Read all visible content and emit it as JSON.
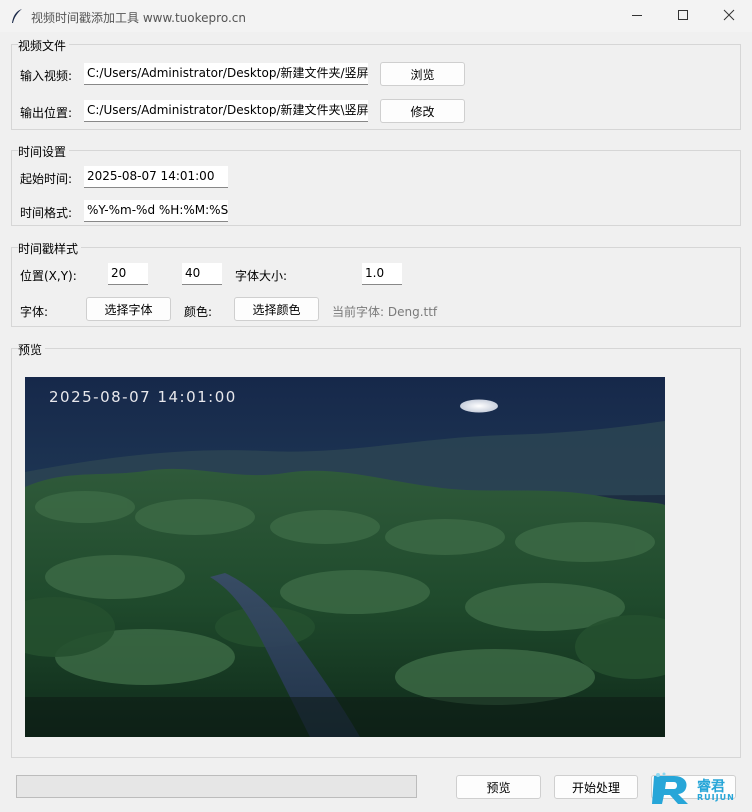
{
  "window": {
    "title": "视频时间戳添加工具  www.tuokepro.cn"
  },
  "video_file": {
    "group_label": "视频文件",
    "input_label": "输入视频:",
    "input_value": "C:/Users/Administrator/Desktop/新建文件夹/竖屏",
    "browse_label": "浏览",
    "output_label": "输出位置:",
    "output_value": "C:/Users/Administrator/Desktop/新建文件夹\\竖屏",
    "modify_label": "修改"
  },
  "time_settings": {
    "group_label": "时间设置",
    "start_label": "起始时间:",
    "start_value": "2025-08-07 14:01:00",
    "format_label": "时间格式:",
    "format_value": "%Y-%m-%d %H:%M:%S"
  },
  "style": {
    "group_label": "时间戳样式",
    "position_label": "位置(X,Y):",
    "x_value": "20",
    "y_value": "40",
    "font_size_label": "字体大小:",
    "font_size_value": "1.0",
    "font_label": "字体:",
    "choose_font_label": "选择字体",
    "color_label": "颜色:",
    "choose_color_label": "选择颜色",
    "current_font_text": "当前字体: Deng.ttf"
  },
  "preview": {
    "group_label": "预览",
    "timestamp_overlay": "2025-08-07 14:01:00"
  },
  "actions": {
    "preview_label": "预览",
    "start_label": "开始处理",
    "progress": 0
  },
  "watermark": {
    "text": "睿君",
    "sub": "RUIJUN"
  },
  "colors": {
    "accent": "#27a6d8",
    "window_bg": "#f0f0f0"
  }
}
